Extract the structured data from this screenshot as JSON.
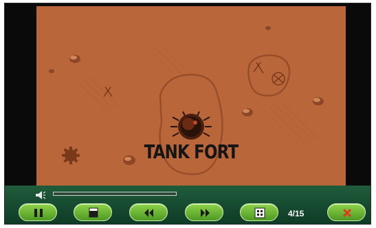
{
  "video": {
    "title_text": "TANK FORT"
  },
  "controls": {
    "page_counter": "4/15",
    "buttons": [
      {
        "name": "pause-button",
        "icon": "pause-icon"
      },
      {
        "name": "stop-button",
        "icon": "stop-icon"
      },
      {
        "name": "rewind-button",
        "icon": "rewind-icon"
      },
      {
        "name": "fast-forward-button",
        "icon": "fast-forward-icon"
      },
      {
        "name": "fullscreen-button",
        "icon": "fullscreen-icon"
      },
      {
        "name": "close-button",
        "icon": "close-icon"
      }
    ],
    "volume_icon": "speaker-icon",
    "seek_progress": 0
  },
  "colors": {
    "video_background": "#b9663a",
    "control_bar": "#1f5c3c",
    "button_green": "#6fbf36",
    "close_icon": "#e23a1c"
  }
}
